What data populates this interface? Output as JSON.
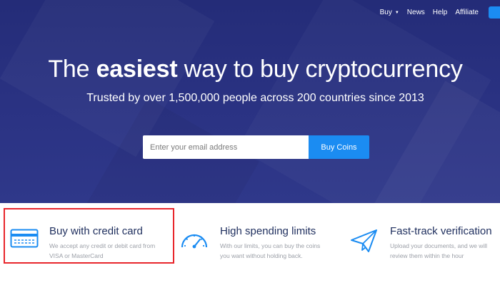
{
  "nav": {
    "items": [
      {
        "label": "Buy",
        "has_caret": true
      },
      {
        "label": "News"
      },
      {
        "label": "Help"
      },
      {
        "label": "Affiliate"
      }
    ]
  },
  "hero": {
    "headline_prefix": "The ",
    "headline_bold": "easiest",
    "headline_suffix": " way to buy cryptocurrency",
    "subtitle": "Trusted by over 1,500,000 people across 200 countries since 2013",
    "email_placeholder": "Enter your email address",
    "cta_label": "Buy Coins"
  },
  "features": [
    {
      "title": "Buy with credit card",
      "desc_line1": "We accept any credit or debit card from",
      "desc_line2": "VISA or MasterCard",
      "icon": "credit-card-icon"
    },
    {
      "title": "High spending limits",
      "desc_line1": "With our limits, you can buy the coins",
      "desc_line2": "you want without holding back.",
      "icon": "speedometer-icon"
    },
    {
      "title": "Fast-track verification",
      "desc_line1": "Upload your documents, and we will",
      "desc_line2": "review them within the hour",
      "icon": "paper-plane-icon"
    }
  ],
  "colors": {
    "hero_bg": "#262e7a",
    "accent": "#1b8cf2",
    "feature_title": "#1f2f5e",
    "highlight_border": "#e8262c"
  }
}
